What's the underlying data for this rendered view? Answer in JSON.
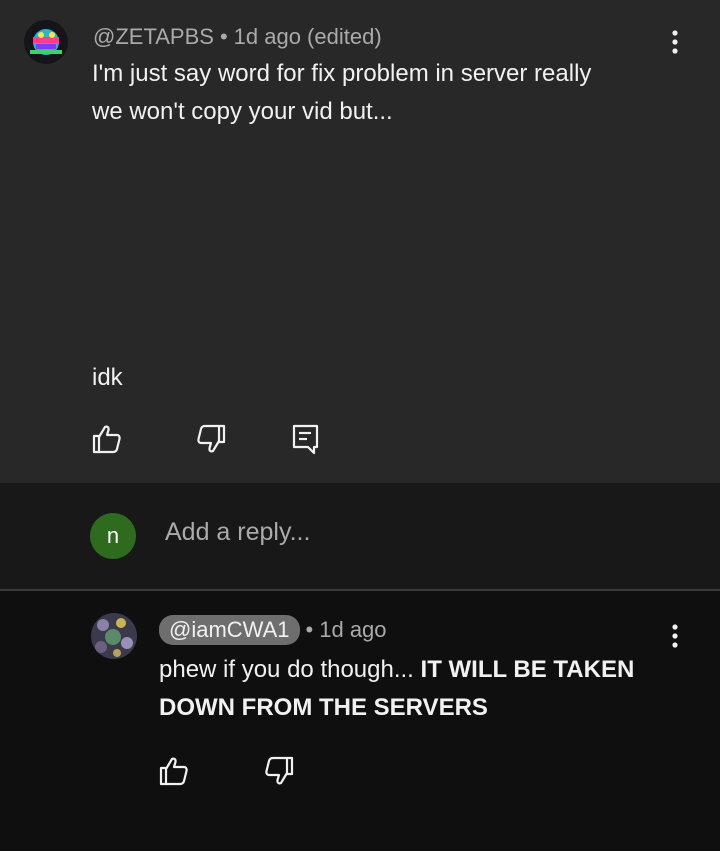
{
  "comment": {
    "author": "@ZETAPBS",
    "time": "1d ago (edited)",
    "line1": "I'm just say word for fix problem in server really",
    "line2": "we won't copy your vid but...",
    "extra": "idk"
  },
  "reply_box": {
    "avatar_letter": "n",
    "placeholder": "Add a reply..."
  },
  "reply": {
    "author": "@iamCWA1",
    "time": "1d ago",
    "text_plain": "phew if you do though...",
    "text_bold_1": "IT WILL BE TAKEN",
    "text_bold_2": "DOWN FROM THE SERVERS"
  },
  "icons": {
    "like": "thumbs-up-icon",
    "dislike": "thumbs-down-icon",
    "reply": "reply-comment-icon",
    "more": "more-vertical-icon"
  }
}
